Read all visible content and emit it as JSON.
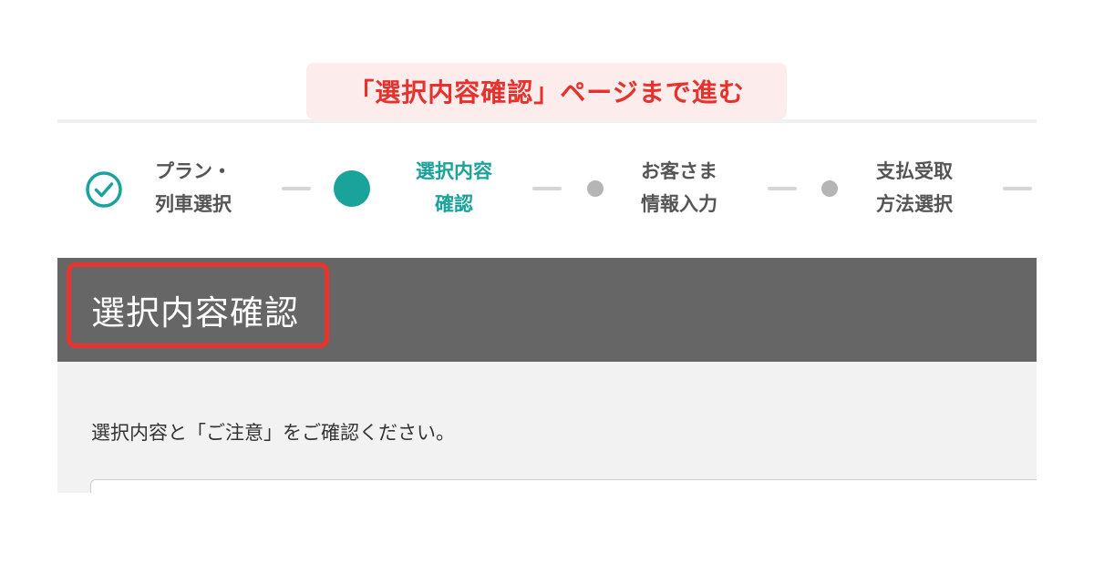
{
  "callout": {
    "text": "「選択内容確認」ページまで進む"
  },
  "stepper": {
    "steps": [
      {
        "line1": "プラン・",
        "line2": "列車選択",
        "state": "done"
      },
      {
        "line1": "選択内容",
        "line2": "確認",
        "state": "current"
      },
      {
        "line1": "お客さま",
        "line2": "情報入力",
        "state": "upcoming"
      },
      {
        "line1": "支払受取",
        "line2": "方法選択",
        "state": "upcoming"
      }
    ]
  },
  "header": {
    "title": "選択内容確認"
  },
  "main": {
    "instruction": "選択内容と「ご注意」をご確認ください。"
  },
  "colors": {
    "accent": "#1aa39b",
    "highlight": "#e8342f",
    "header_bg": "#666666",
    "callout_bg": "#fdecec"
  },
  "icons": {
    "done_step": "check-circle-icon"
  }
}
